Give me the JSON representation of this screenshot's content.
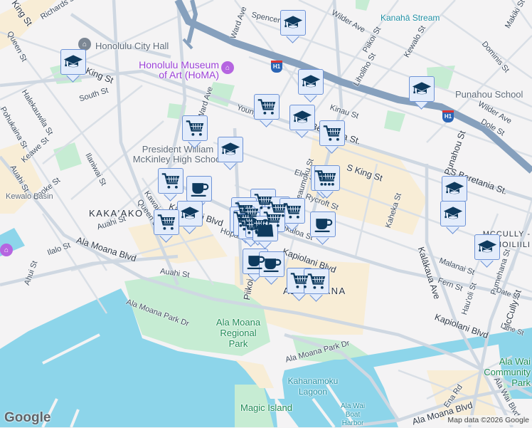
{
  "map": {
    "labels": {
      "king_st_nw": "King St",
      "richards_st": "Richards St",
      "queen_st": "Queen St",
      "city_hall": "Honolulu City Hall",
      "homa": "Honolulu Museum of Art (HoMA)",
      "king_st": "King St",
      "south_st": "South St",
      "halekauwila_st": "Halekauwila St",
      "pohukaina_st": "Pohukaina St",
      "keawe_st": "Keawe St",
      "auahi_st_w": "Auahi St",
      "cooke_st": "Cooke St",
      "ilaniwai_st": "Ilaniwai St",
      "ward_ave_top": "Ward Ave",
      "ward_ave": "Ward Ave",
      "spencer_st": "Spencer St",
      "young_st": "Young St",
      "mckinley": "President William McKinley High School",
      "kakaako": "KAKA'AKO",
      "kewalo_basin": "Kewalo Basin",
      "kawaiahao": "Kawaiahao St",
      "queen_st_2": "Queen St",
      "kapiolani_blvd_w": "Kapiolani Blvd",
      "auahi_st": "Auahi St",
      "ilalo_st": "Ilalo St",
      "ahui_st": "Ahui St",
      "ala_moana_blvd_w": "Ala Moana Blvd",
      "hopaka_st": "Hopaka St",
      "piikoi_st_s": "Piikoi St",
      "wilder_ave": "Wilder Ave",
      "kanaha_stream": "Kanahā Stream",
      "piikoi_st": "Piikoi St",
      "kewalo_st": "Kewalo St",
      "liholiho_st": "Liholiho St",
      "makiki_st": "Makiki St",
      "dominis_st": "Dominis St",
      "punahou_school": "Punahou School",
      "wilder_ave_e": "Wilder Ave",
      "dole_st": "Dole St",
      "kinau_st": "Kinau St",
      "beretania_st": "Beretania St.",
      "s_king_st": "S King St",
      "punahou_st": "Punahou St",
      "s_beretania_st": "S Beretania St.",
      "elm_st": "Elm St",
      "rycroft_st": "Rycroft St",
      "keeaumoku": "Keeaumoku St",
      "kaheka_st": "Kaheka St",
      "makaloa_st": "Makaloa St",
      "kapiolani_blvd": "Kapiolani Blvd",
      "kapiolani_blvd_e": "Kapiolani Blvd",
      "ala_moana": "ALA MOANA",
      "kalakaua_ave": "Kalākaua Ave",
      "mccully_moiliili": "MCCULLY - MOILIILI",
      "malanai_st": "Malanai St",
      "fern_st": "Fern St",
      "hauoli_st": "Hau'oli St",
      "pumehana_st": "Pumehana St",
      "mccully_st": "McCully St",
      "lime_st": "Lime St",
      "date_st": "Date St",
      "ala_moana_park": "Ala Moana Regional Park",
      "ala_moana_park_dr": "Ala Moana Park Dr",
      "ala_moana_park_dr_e": "Ala Moana Park Dr",
      "kahanamoku_lagoon": "Kahanamoku Lagoon",
      "ala_wai_harbor": "Ala Wai Boat Harbor",
      "magic_island": "Magic Island",
      "ena_rd": "Ena Rd",
      "ala_moana_blvd_e": "Ala Moana Blvd",
      "ala_wai_community_park": "Ala Wai Community Park",
      "ala_wai_blvd": "Ala Wai Blvd"
    },
    "highway_shield": "H1",
    "marker_types": [
      "school",
      "shopping-cart",
      "coffee",
      "shopping-bag"
    ],
    "google_logo": "Google",
    "attribution": "Map data ©2026 Google"
  },
  "colors": {
    "marker_fill": "#e3ecfb",
    "marker_border": "#6e93d6",
    "marker_icon": "#0e3a5e",
    "water": "#8dd5ea",
    "park": "#c6ecd3",
    "highway": "#86a0bd"
  }
}
